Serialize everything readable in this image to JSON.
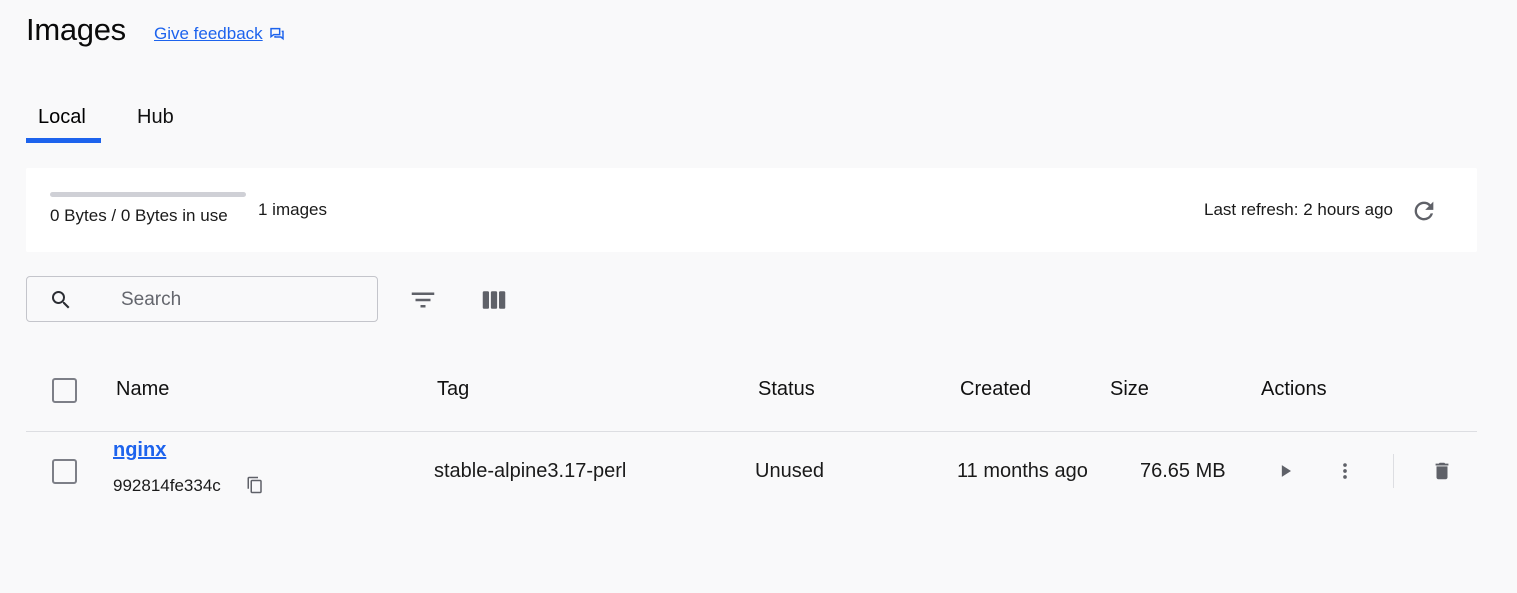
{
  "header": {
    "title": "Images",
    "feedback_label": "Give feedback",
    "feedback_icon": "feedback-chat-icon"
  },
  "tabs": [
    {
      "label": "Local",
      "active": true
    },
    {
      "label": "Hub",
      "active": false
    }
  ],
  "summary": {
    "usage_fraction": 0,
    "usage_text": "0 Bytes / 0 Bytes in use",
    "images_count": "1 images",
    "last_refresh": "Last refresh: 2 hours ago",
    "refresh_icon": "refresh-icon"
  },
  "toolbar": {
    "search_placeholder": "Search",
    "search_value": "",
    "filter_icon": "filter-icon",
    "columns_icon": "columns-icon"
  },
  "table": {
    "headers": [
      "Name",
      "Tag",
      "Status",
      "Created",
      "Size",
      "Actions"
    ],
    "rows": [
      {
        "name": "nginx",
        "id": "992814fe334c",
        "tag": "stable-alpine3.17-perl",
        "status": "Unused",
        "created": "11 months ago",
        "size": "76.65 MB",
        "selected": false
      }
    ]
  },
  "colors": {
    "accent": "#1d63ed",
    "background": "#f9f9fa",
    "card": "#ffffff",
    "icon": "#5f6168"
  }
}
